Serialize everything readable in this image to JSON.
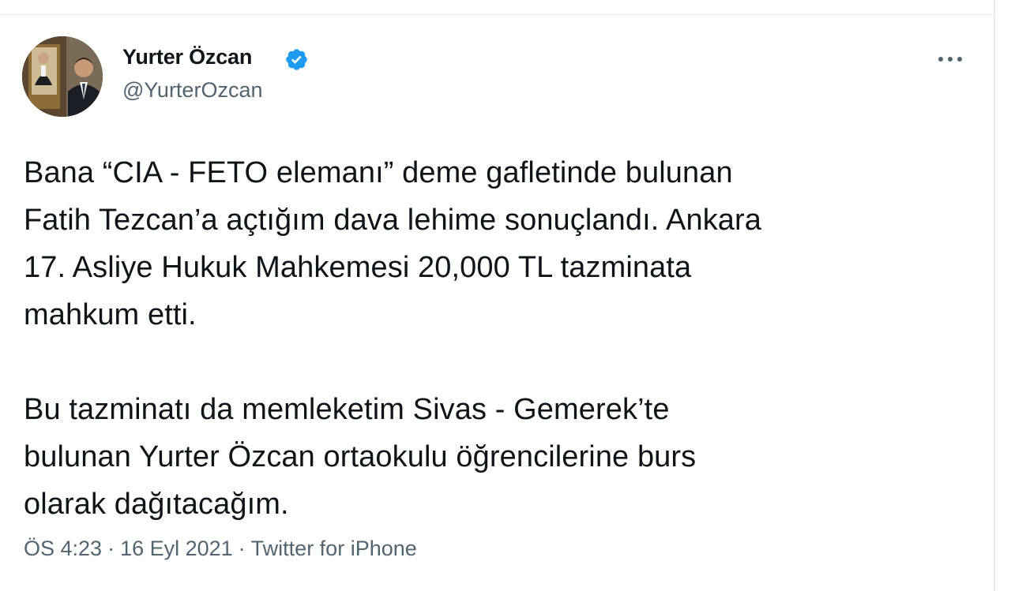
{
  "author": {
    "display_name": "Yurter Özcan",
    "handle": "@YurterOzcan",
    "verified": true,
    "avatar_icon": "profile-photo"
  },
  "tweet": {
    "paragraphs": [
      "Bana “CIA - FETO elemanı” deme gafletinde bulunan\nFatih Tezcan’a açtığım dava lehime sonuçlandı. Ankara\n17. Asliye Hukuk Mahkemesi 20,000 TL tazminata\nmahkum etti.",
      "Bu tazminatı da memleketim Sivas - Gemerek’te\nbulunan Yurter Özcan ortaokulu öğrencilerine burs\nolarak dağıtacağım."
    ]
  },
  "meta": {
    "time": "ÖS 4:23",
    "separator": "·",
    "date": "16 Eyl 2021",
    "source": "Twitter for iPhone"
  },
  "more_icon": "more-horizontal-icon",
  "colors": {
    "primary_text": "#0f1419",
    "secondary_text": "#536471",
    "verified_blue": "#1d9bf0",
    "divider": "#e6ecf0"
  }
}
